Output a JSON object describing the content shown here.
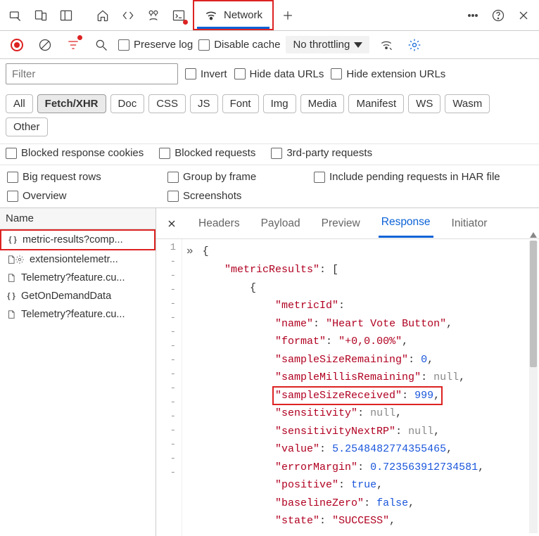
{
  "topTabs": {
    "networkLabel": "Network"
  },
  "toolbar": {
    "preserveLog": "Preserve log",
    "disableCache": "Disable cache",
    "throttling": "No throttling"
  },
  "filterRow": {
    "placeholder": "Filter",
    "invert": "Invert",
    "hideDataUrls": "Hide data URLs",
    "hideExtUrls": "Hide extension URLs"
  },
  "typeChips": [
    "All",
    "Fetch/XHR",
    "Doc",
    "CSS",
    "JS",
    "Font",
    "Img",
    "Media",
    "Manifest",
    "WS",
    "Wasm",
    "Other"
  ],
  "typeActive": "Fetch/XHR",
  "blockedRow": {
    "blockedRespCookies": "Blocked response cookies",
    "blockedReq": "Blocked requests",
    "thirdParty": "3rd-party requests"
  },
  "options": {
    "bigRequestRows": "Big request rows",
    "groupByFrame": "Group by frame",
    "includePending": "Include pending requests in HAR file",
    "overview": "Overview",
    "screenshots": "Screenshots"
  },
  "list": {
    "header": "Name",
    "items": [
      {
        "icon": "json",
        "label": "metric-results?comp...",
        "selected": true
      },
      {
        "icon": "gear",
        "label": "extensiontelemetr..."
      },
      {
        "icon": "doc",
        "label": "Telemetry?feature.cu..."
      },
      {
        "icon": "json",
        "label": "GetOnDemandData"
      },
      {
        "icon": "doc",
        "label": "Telemetry?feature.cu..."
      }
    ]
  },
  "detailTabs": [
    "Headers",
    "Payload",
    "Preview",
    "Response",
    "Initiator"
  ],
  "detailActive": "Response",
  "lineNumbers": [
    "1",
    "-",
    "-",
    "-",
    "-",
    "-",
    "-",
    "-",
    "-",
    "-",
    "-",
    "-",
    "-",
    "-",
    "-",
    "-",
    "-"
  ],
  "response": {
    "root": "metricResults",
    "fields": [
      {
        "key": "metricId",
        "type": "nokey-cont"
      },
      {
        "key": "name",
        "val": "Heart Vote Button",
        "type": "string"
      },
      {
        "key": "format",
        "val": "+0,0.00%",
        "type": "string"
      },
      {
        "key": "sampleSizeRemaining",
        "val": "0",
        "type": "number"
      },
      {
        "key": "sampleMillisRemaining",
        "val": "null",
        "type": "null"
      },
      {
        "key": "sampleSizeReceived",
        "val": "999",
        "type": "number",
        "highlight": true
      },
      {
        "key": "sensitivity",
        "val": "null",
        "type": "null"
      },
      {
        "key": "sensitivityNextRP",
        "val": "null",
        "type": "null"
      },
      {
        "key": "value",
        "val": "5.2548482774355465",
        "type": "number"
      },
      {
        "key": "errorMargin",
        "val": "0.723563912734581",
        "type": "number"
      },
      {
        "key": "positive",
        "val": "true",
        "type": "bool"
      },
      {
        "key": "baselineZero",
        "val": "false",
        "type": "bool"
      },
      {
        "key": "state",
        "val": "SUCCESS",
        "type": "string"
      }
    ]
  }
}
